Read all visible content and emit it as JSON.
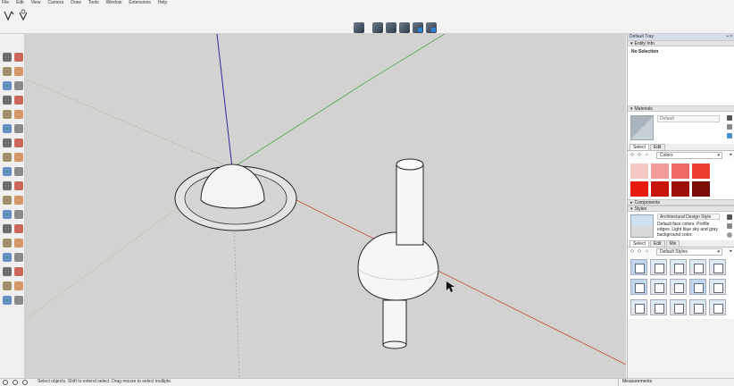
{
  "menu": [
    "File",
    "Edit",
    "View",
    "Camera",
    "Draw",
    "Tools",
    "Window",
    "Extensions",
    "Help"
  ],
  "toolbar": {
    "top_icons": [
      "xyz-axis-icon",
      "sun-axis-icon"
    ],
    "view_buttons": [
      "iso-view-icon",
      "top-view-icon",
      "front-view-icon",
      "right-view-icon",
      "back-view-icon",
      "left-view-icon"
    ]
  },
  "left_tools": [
    "select-tool-icon",
    "eraser-tool-icon",
    "paint-bucket-icon",
    "eraser-icon",
    "line-tool-icon",
    "freehand-icon",
    "rectangle-icon",
    "rotated-rectangle-icon",
    "circle-icon",
    "polygon-icon",
    "arc-icon",
    "pie-icon",
    "two-point-arc-icon",
    "three-point-arc-icon",
    "move-icon",
    "push-pull-icon",
    "rotate-icon",
    "follow-me-icon",
    "scale-icon",
    "offset-icon",
    "tape-measure-icon",
    "dimension-icon",
    "protractor-icon",
    "text-icon",
    "axes-icon",
    "3d-text-icon",
    "orbit-icon",
    "pan-icon",
    "zoom-icon",
    "zoom-window-icon",
    "zoom-extents-icon",
    "previous-view-icon",
    "position-camera-icon",
    "look-around-icon",
    "walk-icon",
    "section-plane-icon"
  ],
  "tray": {
    "title": "Default Tray",
    "entity_info": {
      "header": "Entity Info",
      "selection": "No Selection"
    },
    "materials": {
      "header": "Materials",
      "name": "Default",
      "tabs": [
        "Select",
        "Edit"
      ],
      "library": "Colors",
      "colors": [
        "#f6c9c4",
        "#f19d97",
        "#ef6a62",
        "#ec3f34",
        "#e81a10",
        "#c9140c",
        "#9e0f09",
        "#7a0c07"
      ]
    },
    "components": {
      "header": "Components"
    },
    "styles": {
      "header": "Styles",
      "name": "Architectural Design Style",
      "description": "Default face colors. Profile edges. Light blue sky and gray background color.",
      "tabs": [
        "Select",
        "Edit",
        "Mix"
      ],
      "library": "Default Styles",
      "thumb_count": 15
    }
  },
  "status": {
    "text": "Select objects. Shift to extend select. Drag mouse to select multiple.",
    "measurements_label": "Measurements"
  },
  "colors": {
    "axis_red": "#c0392b",
    "axis_green": "#3a9a3a",
    "axis_blue": "#2b2b9a",
    "canvas_bg": "#d2d2d0"
  }
}
